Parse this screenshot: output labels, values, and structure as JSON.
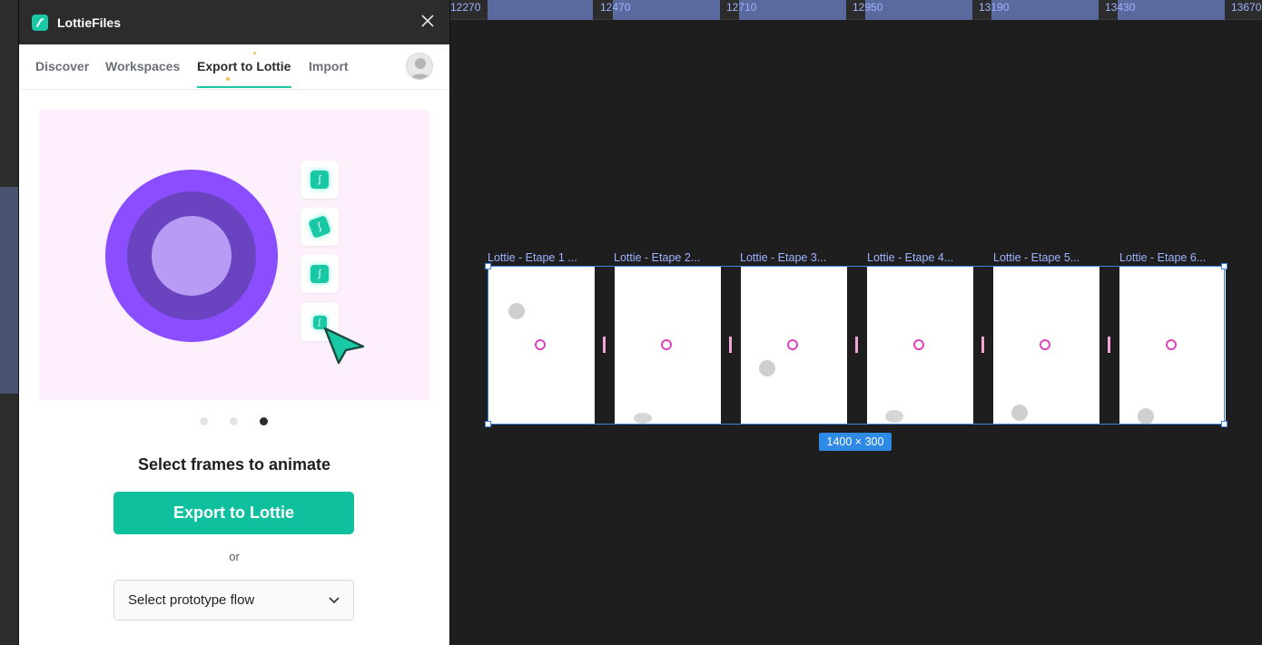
{
  "plugin": {
    "title": "LottieFiles",
    "logo_icon": "lottie-logo-icon",
    "accent_color": "#19c9a5",
    "tabs": [
      {
        "label": "Discover"
      },
      {
        "label": "Workspaces"
      },
      {
        "label": "Export to Lottie"
      },
      {
        "label": "Import"
      }
    ],
    "active_tab": "Export to Lottie",
    "carousel": {
      "page_count": 3,
      "active_index": 3
    },
    "headline": "Select frames to animate",
    "export_button_label": "Export to Lottie",
    "or_text": "or",
    "prototype_select": {
      "value": "Select prototype flow"
    }
  },
  "canvas": {
    "ruler_labels": [
      "12270",
      "12470",
      "12710",
      "12950",
      "13190",
      "13430",
      "13670"
    ],
    "frames": [
      {
        "label": "Lottie - Etape 1 ..."
      },
      {
        "label": "Lottie - Etape 2..."
      },
      {
        "label": "Lottie - Etape 3..."
      },
      {
        "label": "Lottie - Etape 4..."
      },
      {
        "label": "Lottie - Etape 5..."
      },
      {
        "label": "Lottie - Etape 6..."
      }
    ],
    "selection_size": "1400 × 300",
    "selection_color": "#3d86e0"
  }
}
